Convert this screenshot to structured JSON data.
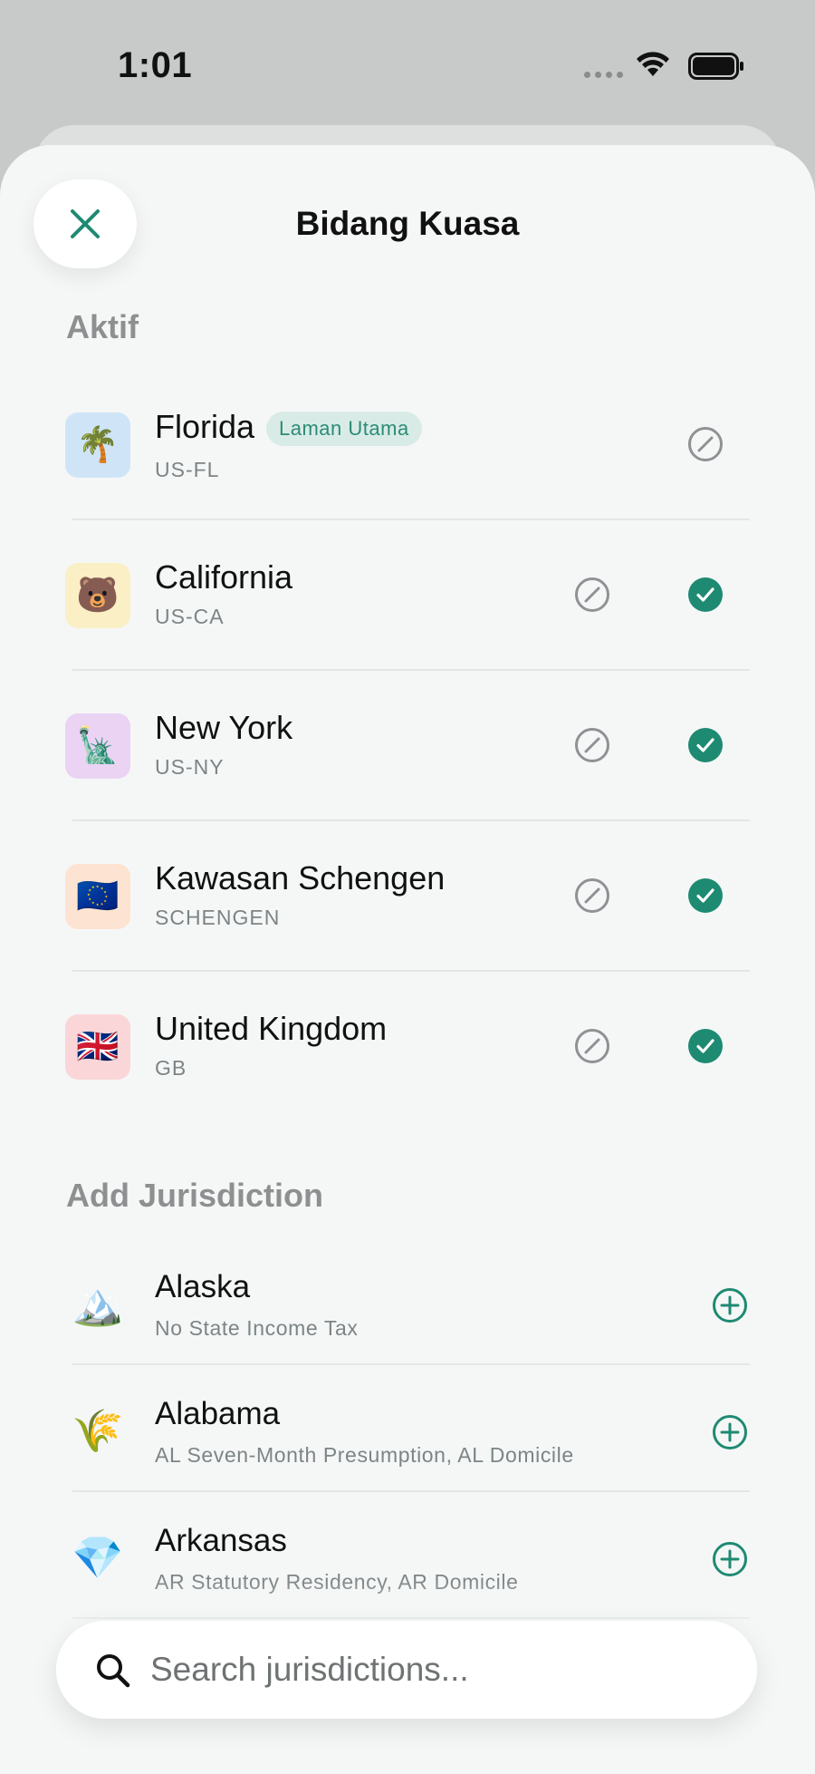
{
  "status_bar": {
    "time": "1:01"
  },
  "sheet": {
    "title": "Bidang Kuasa"
  },
  "active_section": {
    "title": "Aktif",
    "items": [
      {
        "name": "Florida",
        "code": "US-FL",
        "emoji": "🌴",
        "icon_bg": "#cfe5f7",
        "badge": "Laman Utama",
        "checked": false
      },
      {
        "name": "California",
        "code": "US-CA",
        "emoji": "🐻",
        "icon_bg": "#fbefc6",
        "checked": true
      },
      {
        "name": "New York",
        "code": "US-NY",
        "emoji": "🗽",
        "icon_bg": "#ead3f3",
        "checked": true
      },
      {
        "name": "Kawasan Schengen",
        "code": "SCHENGEN",
        "emoji": "🇪🇺",
        "icon_bg": "#fde3d1",
        "checked": true
      },
      {
        "name": "United Kingdom",
        "code": "GB",
        "emoji": "🇬🇧",
        "icon_bg": "#fbd6d9",
        "checked": true
      }
    ]
  },
  "add_section": {
    "title": "Add Jurisdiction",
    "items": [
      {
        "name": "Alaska",
        "desc": "No State Income Tax",
        "emoji": "🏔️"
      },
      {
        "name": "Alabama",
        "desc": "AL Seven-Month Presumption, AL Domicile",
        "emoji": "🌾"
      },
      {
        "name": "Arkansas",
        "desc": "AR Statutory Residency, AR Domicile",
        "emoji": "💎"
      }
    ]
  },
  "search": {
    "placeholder": "Search jurisdictions..."
  },
  "colors": {
    "accent": "#1e8a72",
    "sheet_bg": "#f5f7f7",
    "muted": "#8e8f90"
  }
}
